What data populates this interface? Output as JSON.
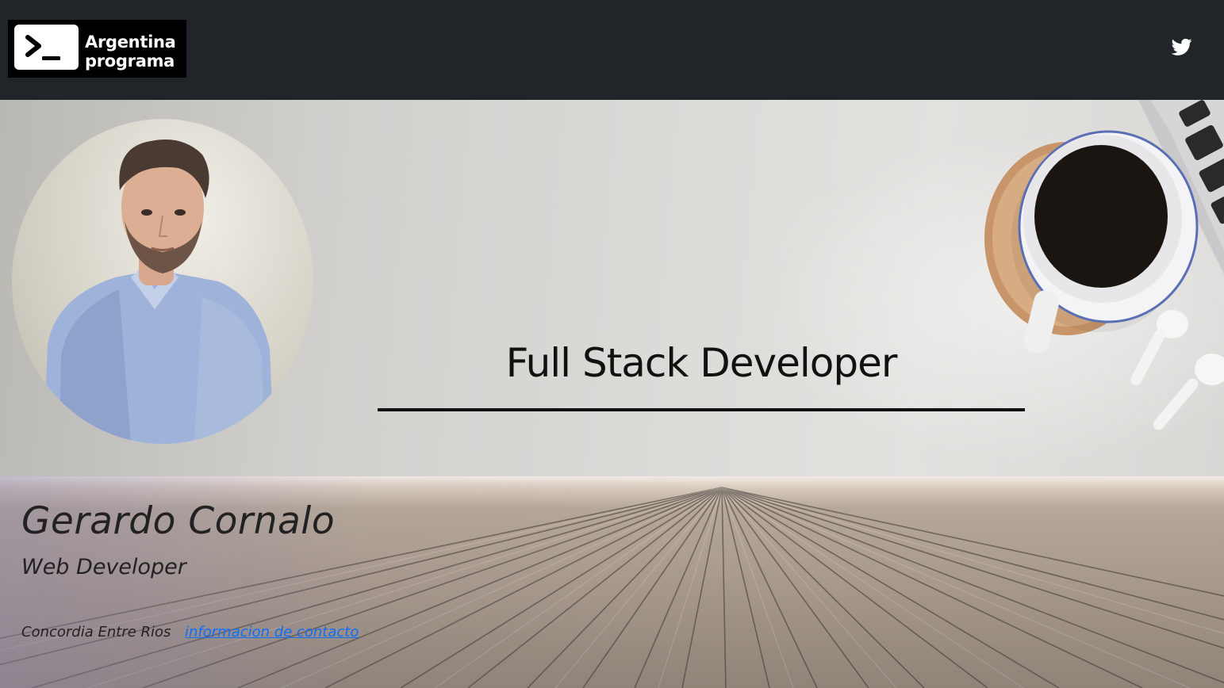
{
  "navbar": {
    "logo_line1": "Argentina",
    "logo_line2": "programa",
    "social_icon": "twitter-icon",
    "background_color": "#212529"
  },
  "banner": {
    "headline": "Full Stack Developer"
  },
  "profile": {
    "name": "Gerardo Cornalo",
    "role": "Web Developer",
    "location": "Concordia Entre Rios",
    "contact_link": "informacion de contacto",
    "link_color": "#0d6efd"
  }
}
